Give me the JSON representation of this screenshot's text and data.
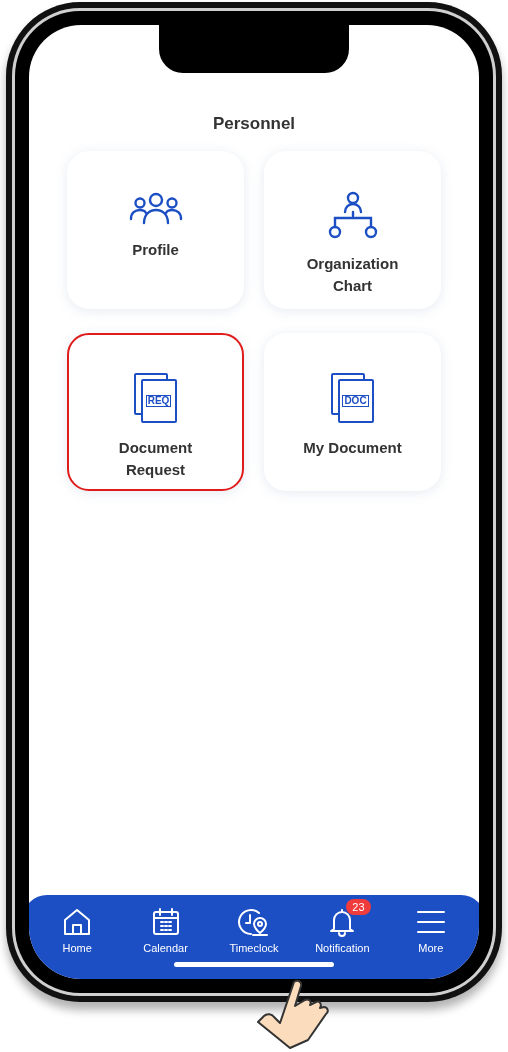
{
  "section_title": "Personnel",
  "tiles": [
    {
      "kind": "people",
      "label": "Profile",
      "selected": false
    },
    {
      "kind": "org-chart",
      "label": "Organization Chart",
      "selected": false
    },
    {
      "kind": "document",
      "icon_text": "REQ",
      "label": "Document Request",
      "selected": true
    },
    {
      "kind": "document",
      "icon_text": "DOC",
      "label": "My Document",
      "selected": false
    }
  ],
  "nav": [
    {
      "kind": "home",
      "label": "Home"
    },
    {
      "kind": "calendar",
      "label": "Calendar"
    },
    {
      "kind": "timeclock",
      "label": "Timeclock"
    },
    {
      "kind": "bell",
      "label": "Notification",
      "badge": "23"
    },
    {
      "kind": "menu",
      "label": "More"
    }
  ]
}
